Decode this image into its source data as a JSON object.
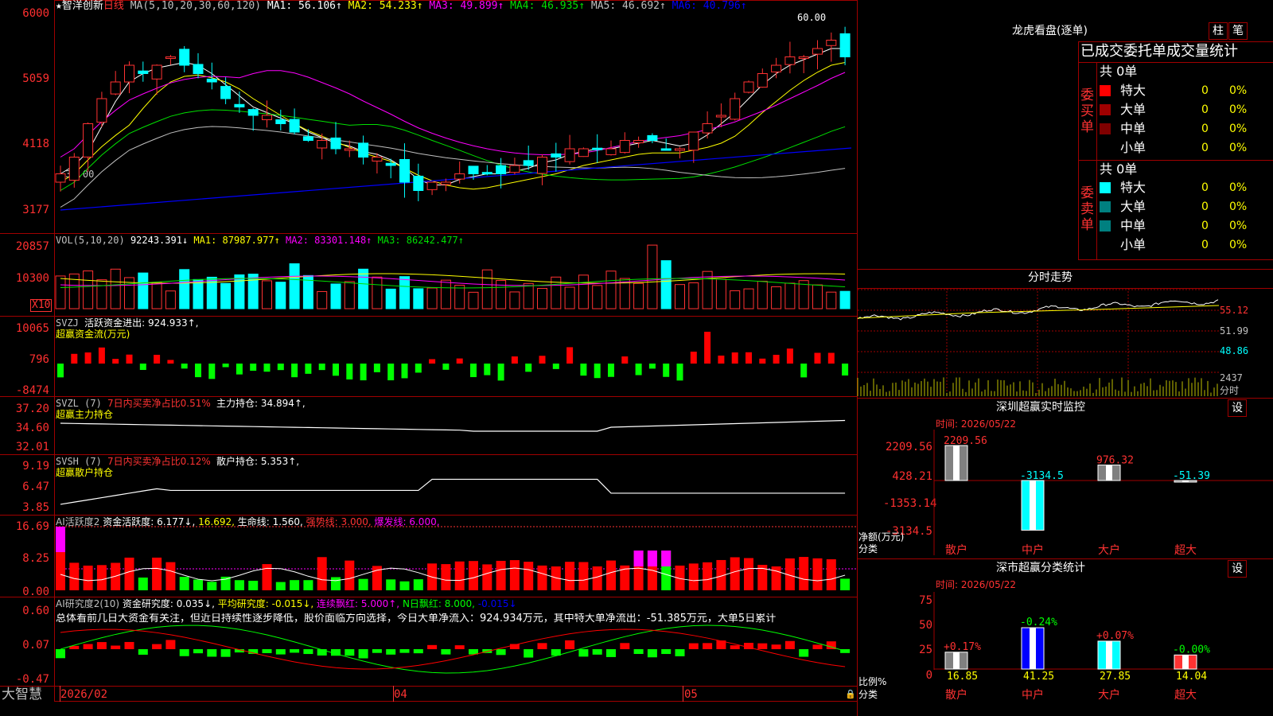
{
  "colors": {
    "up": "#ff3232",
    "down": "#00ffff",
    "ma1": "#ffffff",
    "ma2": "#ffff00",
    "ma3": "#ff00ff",
    "ma4": "#00e000",
    "ma5": "#c0c0c0",
    "ma6": "#0000ff",
    "grid": "#a00000"
  },
  "main": {
    "title": "智洋创新",
    "period": "日线",
    "ma_params": "MA(5,10,20,30,60,120)",
    "ma1": "MA1: 56.106↑",
    "ma2": "MA2: 54.233↑",
    "ma3": "MA3: 49.899↑",
    "ma4": "MA4: 46.935↑",
    "ma5": "MA5: 46.692↑",
    "ma6": "MA6: 40.796↑",
    "y_labels": [
      "6000",
      "5059",
      "4118",
      "3177"
    ],
    "high_mark": "60.00",
    "low_mark": "←37.00",
    "x_labels": [
      "2026/02",
      "04",
      "05"
    ],
    "star_mark": "★"
  },
  "vol": {
    "title": "VOL(5,10,20)",
    "value": "92243.391↓",
    "ma1": "MA1: 87987.977↑",
    "ma2": "MA2: 83301.148↑",
    "ma3": "MA3: 86242.477↑",
    "y_labels": [
      "20857",
      "10300"
    ],
    "unit": "X10"
  },
  "svzj": {
    "title": "SVZJ",
    "label": "活跃资金进出: 924.933↑,",
    "sub": "超赢资金流(万元)",
    "y_labels": [
      "10065",
      "796",
      "-8474"
    ]
  },
  "svzl": {
    "title": "SVZL (7)",
    "ratio": "7日内买卖净占比0.51%",
    "label": "主力持仓: 34.894↑,",
    "sub": "超赢主力持仓",
    "y_labels": [
      "37.20",
      "34.60",
      "32.01"
    ]
  },
  "svsh": {
    "title": "SVSH (7)",
    "ratio": "7日内买卖净占比0.12%",
    "label": "散户持仓: 5.353↑,",
    "sub": "超赢散户持仓",
    "y_labels": [
      "9.19",
      "6.47",
      "3.85"
    ]
  },
  "ai1": {
    "title": "AI活跃度2",
    "label1": "资金活跃度: 6.177↓,",
    "label2": "16.692,",
    "label3": "生命线: 1.560,",
    "label4": "强势线: 3.000,",
    "label5": "爆发线: 6.000,",
    "y_labels": [
      "16.69",
      "8.25",
      "0.00"
    ]
  },
  "ai2": {
    "title": "AI研究度2(10)",
    "label1": "资金研究度: 0.035↓,",
    "label2": "平均研究度: -0.015↓,",
    "label3": "连续飘红: 5.000↑,",
    "label4": "N日飘红: 8.000,",
    "label5": "-0.015↓",
    "summary": "总体看前几日大资金有关注，但近日持续性逐步降低，股价面临方向选择，今日大单净流入：924.934万元，其中特大单净流出：-51.385万元，大单5日累计",
    "y_labels": [
      "0.60",
      "0.07",
      "-0.47"
    ]
  },
  "brand": "大智慧",
  "right": {
    "lhb_title": "龙虎看盘(逐单)",
    "btn_zhu": "柱",
    "btn_bi": "笔",
    "stats_title": "已成交委托单成交量统计",
    "buy_side": "委买单",
    "sell_side": "委卖单",
    "buy_total": "共 0单",
    "sell_total": "共 0单",
    "rows": [
      {
        "name": "特大",
        "val": "0",
        "pct": "0%",
        "color": "#ff0000"
      },
      {
        "name": "大单",
        "val": "0",
        "pct": "0%",
        "color": "#a00000"
      },
      {
        "name": "中单",
        "val": "0",
        "pct": "0%",
        "color": "#800000"
      },
      {
        "name": "小单",
        "val": "0",
        "pct": "0%",
        "color": ""
      }
    ],
    "sell_rows": [
      {
        "name": "特大",
        "val": "0",
        "pct": "0%",
        "color": "#00ffff"
      },
      {
        "name": "大单",
        "val": "0",
        "pct": "0%",
        "color": "#008080"
      },
      {
        "name": "中单",
        "val": "0",
        "pct": "0%",
        "color": "#008080"
      },
      {
        "name": "小单",
        "val": "0",
        "pct": "0%",
        "color": ""
      }
    ],
    "fenshi_title": "分时走势",
    "fenshi_labels": [
      "55.12",
      "51.99",
      "48.86"
    ],
    "fenshi_vol": "2437",
    "fenshi_unit": "分时",
    "monitor_title": "深圳超赢实时监控",
    "monitor_btn": "设",
    "monitor_time": "时间: 2026/05/22",
    "monitor_y": [
      "2209.56",
      "428.21",
      "-1353.14",
      "-3134.5"
    ],
    "monitor_net": "净额(万元)",
    "monitor_fenlei": "分类",
    "monitor_values": [
      "2209.56",
      "-3134.5",
      "976.32",
      "-51.39"
    ],
    "categories": [
      "散户",
      "中户",
      "大户",
      "超大"
    ],
    "stat_title": "深市超赢分类统计",
    "stat_btn": "设",
    "stat_time": "时间: 2026/05/22",
    "stat_y": [
      "75",
      "50",
      "25",
      "0"
    ],
    "stat_ratio": "比例%",
    "stat_fenlei": "分类",
    "stat_changes": [
      "+0.17%",
      "-0.24%",
      "+0.07%",
      "-0.00%"
    ],
    "stat_values": [
      "16.85",
      "41.25",
      "27.85",
      "14.04"
    ]
  },
  "chart_data": {
    "type": "candlestick",
    "monitor_net_values": [
      2209.56,
      -3134.5,
      976.32,
      -51.39
    ],
    "category_ratio": [
      16.85,
      41.25,
      27.85,
      14.04
    ]
  }
}
